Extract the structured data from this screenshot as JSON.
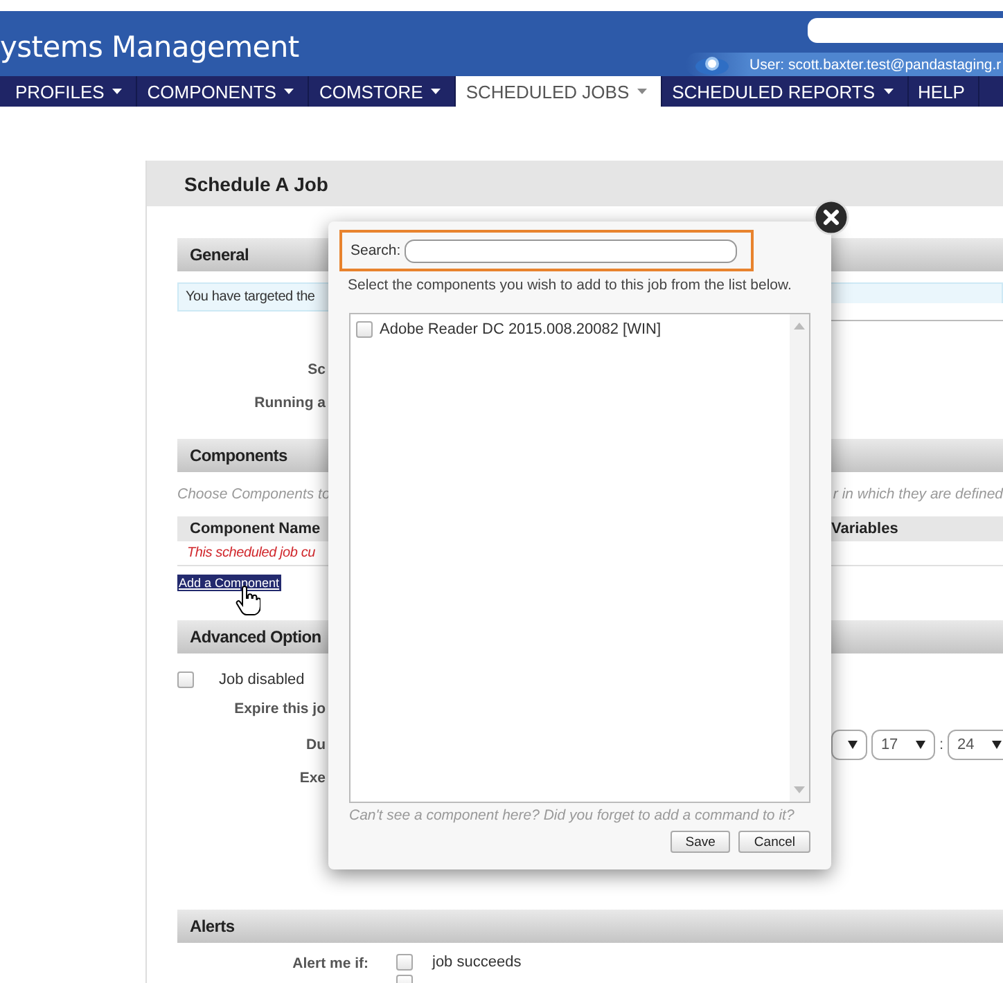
{
  "header": {
    "title": "ystems Management",
    "user": "User: scott.baxter.test@pandastaging.r"
  },
  "nav": [
    {
      "label": "PROFILES",
      "selected": false,
      "dropdown": true
    },
    {
      "label": "COMPONENTS",
      "selected": false,
      "dropdown": true
    },
    {
      "label": "COMSTORE",
      "selected": false,
      "dropdown": true
    },
    {
      "label": "SCHEDULED JOBS",
      "selected": true,
      "dropdown": true
    },
    {
      "label": "SCHEDULED REPORTS",
      "selected": false,
      "dropdown": true
    },
    {
      "label": "HELP",
      "selected": false,
      "dropdown": false
    }
  ],
  "page": {
    "title": "Schedule A Job",
    "general": {
      "heading": "General",
      "notice": "You have targeted the",
      "labels": [
        "Sc",
        "Running a"
      ]
    },
    "components": {
      "heading": "Components",
      "hint": "Choose Components to",
      "hint_right": "r in which they are defined",
      "columns": [
        "Component Name",
        "Variables"
      ],
      "empty_message": "This scheduled job cu",
      "add_link": "Add a Component"
    },
    "advanced": {
      "heading": "Advanced Option",
      "job_disabled": {
        "label": "Job disabled",
        "checked": false
      },
      "expire_label": "Expire this jo",
      "date_label": "Du",
      "time": [
        "17",
        "24"
      ],
      "time_separator": ":",
      "exec_label": "Exe"
    },
    "alerts": {
      "heading": "Alerts",
      "label": "Alert me if:",
      "options": [
        {
          "label": "job succeeds",
          "checked": false
        },
        {
          "checked": false
        }
      ]
    }
  },
  "dialog": {
    "search_label": "Search:",
    "instruction": "Select the components you wish to add to this job from the list below.",
    "items": [
      {
        "label": "Adobe Reader DC 2015.008.20082 [WIN]",
        "checked": false
      }
    ],
    "footnote": "Can't see a component here? Did you forget to add a command to it?",
    "buttons": [
      "Save",
      "Cancel"
    ]
  }
}
